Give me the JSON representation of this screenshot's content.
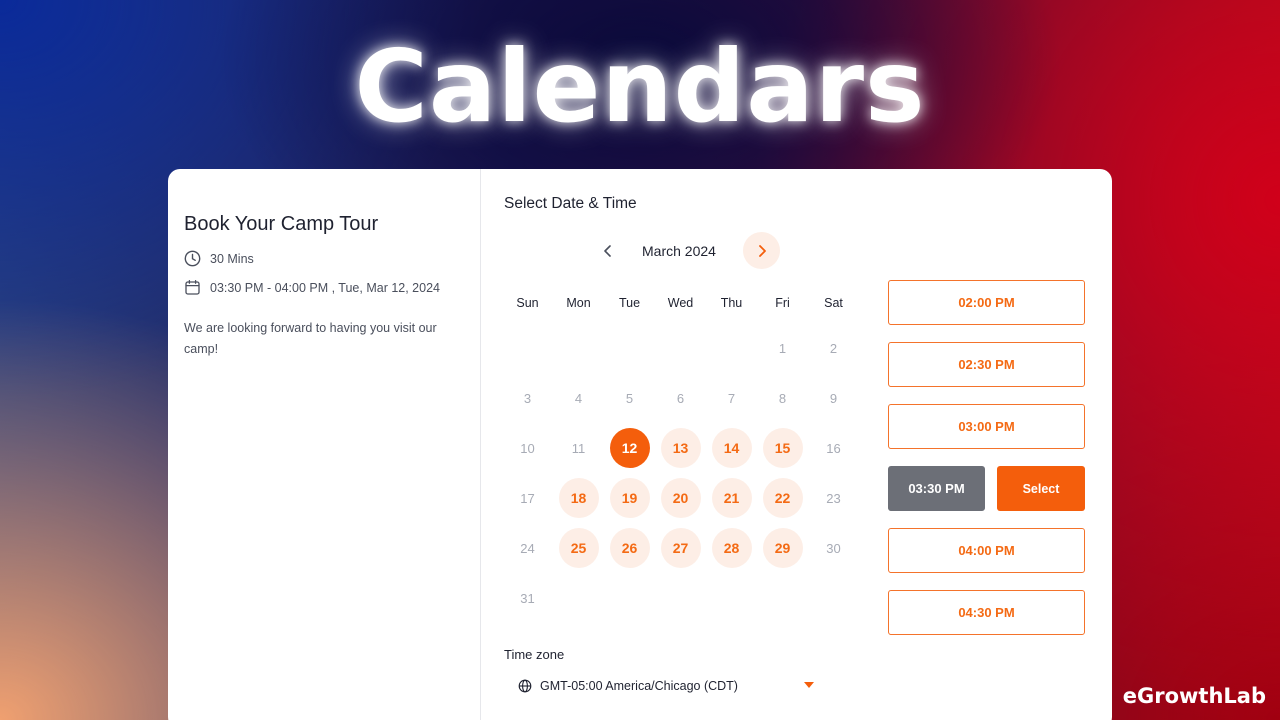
{
  "hero": {
    "title": "Calendars"
  },
  "brand": {
    "name": "eGrowthLab"
  },
  "event": {
    "title": "Book Your Camp Tour",
    "duration": "30 Mins",
    "datetime": "03:30 PM - 04:00 PM , Tue, Mar 12, 2024",
    "description": "We are looking forward to having you visit our camp!"
  },
  "scheduler": {
    "section_title": "Select Date & Time",
    "month_label": "March 2024",
    "weekdays": [
      "Sun",
      "Mon",
      "Tue",
      "Wed",
      "Thu",
      "Fri",
      "Sat"
    ],
    "leading_blanks": 5,
    "days_in_month": 31,
    "selected_day": 12,
    "available_days": [
      13,
      14,
      15,
      18,
      19,
      20,
      21,
      22,
      25,
      26,
      27,
      28,
      29
    ],
    "time_slots": [
      "02:00 PM",
      "02:30 PM",
      "03:00 PM",
      "03:30 PM",
      "04:00 PM",
      "04:30 PM"
    ],
    "active_slot": "03:30 PM",
    "select_label": "Select",
    "timezone_label": "Time zone",
    "timezone_value": "GMT-05:00 America/Chicago (CDT)"
  },
  "colors": {
    "accent": "#f45e0c",
    "accent_soft": "#fdeee6",
    "active_slot_bg": "#6c6f77"
  }
}
